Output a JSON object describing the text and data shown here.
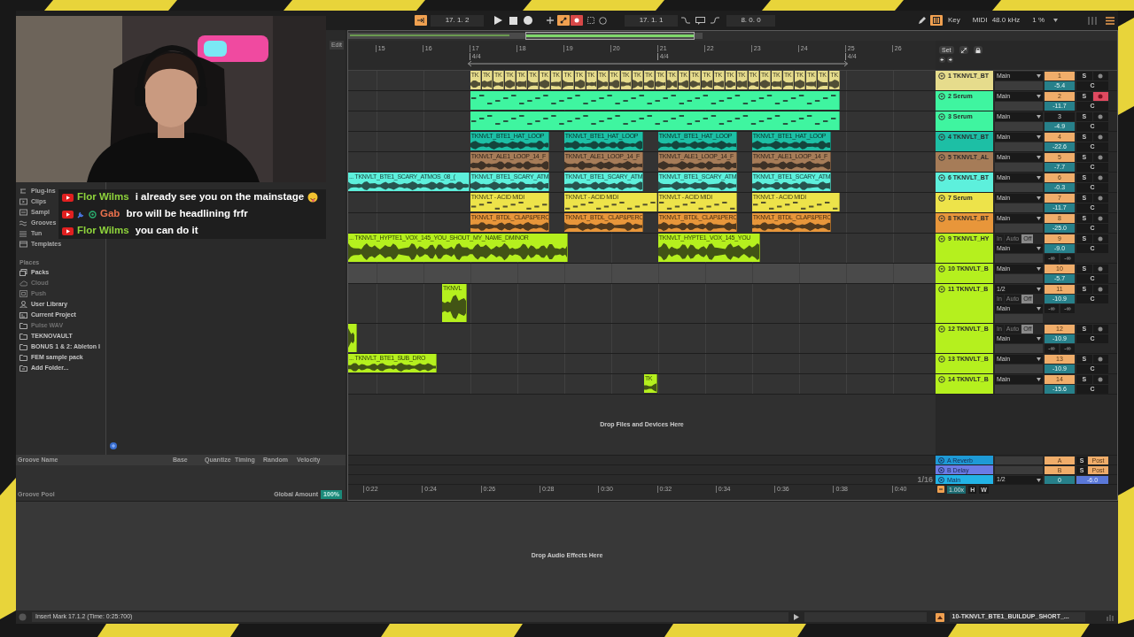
{
  "transport": {
    "position": "17. 1. 2",
    "loop_start": "17. 1. 1",
    "loop_length": "8. 0. 0",
    "key": "Key",
    "midi": "MIDI",
    "sample_rate": "48.0 kHz",
    "cpu": "1 %"
  },
  "chat": [
    {
      "author": "Flor Wilms",
      "color": "#8fd43c",
      "message": "i already see you on the mainstage",
      "kind": "viewer",
      "emoji": true
    },
    {
      "author": "Gab",
      "color": "#e8704c",
      "message": "bro will be headlining frfr",
      "kind": "moderator",
      "emoji": false
    },
    {
      "author": "Flor Wilms",
      "color": "#8fd43c",
      "message": "you can do it",
      "kind": "viewer",
      "emoji": false
    }
  ],
  "browser": {
    "edit": "Edit",
    "categories": [
      {
        "label": "Plug-ins",
        "kind": "plugins"
      },
      {
        "label": "Clips",
        "kind": "clips"
      },
      {
        "label": "Sampl",
        "kind": "samples"
      },
      {
        "label": "Grooves",
        "kind": "grooves"
      },
      {
        "label": "Tun",
        "kind": "tunings"
      },
      {
        "label": "Templates",
        "kind": "templates"
      }
    ],
    "places_title": "Places",
    "places": [
      {
        "label": "Packs",
        "kind": "packs",
        "disabled": false
      },
      {
        "label": "Cloud",
        "kind": "cloud",
        "disabled": true
      },
      {
        "label": "Push",
        "kind": "push",
        "disabled": true
      },
      {
        "label": "User Library",
        "kind": "user",
        "disabled": false
      },
      {
        "label": "Current Project",
        "kind": "project",
        "disabled": false
      },
      {
        "label": "Pulse WAV",
        "kind": "folder",
        "disabled": true
      },
      {
        "label": "TEKNOVAULT",
        "kind": "folder",
        "disabled": false
      },
      {
        "label": "BONUS 1 & 2: Ableton I",
        "kind": "folder",
        "disabled": false
      },
      {
        "label": "FEM sample pack",
        "kind": "folder",
        "disabled": false
      },
      {
        "label": "Add Folder...",
        "kind": "add",
        "disabled": false
      }
    ]
  },
  "groove_pool": {
    "columns": [
      "Groove Name",
      "Base",
      "Quantize",
      "Timing",
      "Random",
      "Velocity"
    ],
    "title": "Groove Pool",
    "amount_label": "Global Amount",
    "amount": "100%"
  },
  "arrangement": {
    "set": "Set",
    "bars": [
      {
        "label": "15"
      },
      {
        "label": "16"
      },
      {
        "label": "17",
        "signature": "4/4"
      },
      {
        "label": "18"
      },
      {
        "label": "19"
      },
      {
        "label": "20"
      },
      {
        "label": "21",
        "signature": "4/4"
      },
      {
        "label": "22"
      },
      {
        "label": "23"
      },
      {
        "label": "24"
      },
      {
        "label": "25",
        "signature": "4/4"
      },
      {
        "label": "26"
      }
    ],
    "tracks": [
      {
        "name": "1 TKNVLT_BT",
        "color": "#e6dc8c",
        "selected": false,
        "io": [
          {
            "kind": "route",
            "label": "Main"
          }
        ],
        "number": "1",
        "active": true,
        "volume": "-5.4",
        "solo": "S",
        "armed": false,
        "pan": "C",
        "clips": [
          {
            "kind": "audio",
            "name": "TK"
          },
          {
            "kind": "audio",
            "name": "TK"
          },
          {
            "kind": "audio",
            "name": "TK"
          },
          {
            "kind": "audio",
            "name": "TK"
          },
          {
            "kind": "audio",
            "name": "TK"
          },
          {
            "kind": "audio",
            "name": "TK"
          },
          {
            "kind": "audio",
            "name": "TK"
          },
          {
            "kind": "audio",
            "name": "TK"
          },
          {
            "kind": "audio",
            "name": "TK"
          },
          {
            "kind": "audio",
            "name": "TK"
          },
          {
            "kind": "audio",
            "name": "TK"
          },
          {
            "kind": "audio",
            "name": "TK"
          },
          {
            "kind": "audio",
            "name": "TK"
          },
          {
            "kind": "audio",
            "name": "TK"
          },
          {
            "kind": "audio",
            "name": "TK"
          },
          {
            "kind": "audio",
            "name": "TK"
          },
          {
            "kind": "audio",
            "name": "TK"
          },
          {
            "kind": "audio",
            "name": "TK"
          },
          {
            "kind": "audio",
            "name": "TK"
          },
          {
            "kind": "audio",
            "name": "TK"
          },
          {
            "kind": "audio",
            "name": "TK"
          },
          {
            "kind": "audio",
            "name": "TK"
          },
          {
            "kind": "audio",
            "name": "TK"
          },
          {
            "kind": "audio",
            "name": "TK"
          },
          {
            "kind": "audio",
            "name": "TK"
          },
          {
            "kind": "audio",
            "name": "TK"
          },
          {
            "kind": "audio",
            "name": "TK"
          },
          {
            "kind": "audio",
            "name": "TK"
          },
          {
            "kind": "audio",
            "name": "TK"
          },
          {
            "kind": "audio",
            "name": "TK"
          },
          {
            "kind": "audio",
            "name": "TK"
          },
          {
            "kind": "audio",
            "name": "TK"
          }
        ]
      },
      {
        "name": "2 Serum",
        "color": "#3ff5a0",
        "selected": false,
        "io": [
          {
            "kind": "route",
            "label": "Main"
          }
        ],
        "number": "2",
        "active": true,
        "volume": "-11.7",
        "solo": "S",
        "armed": true,
        "pan": "C",
        "clips": [
          {
            "kind": "midi"
          }
        ]
      },
      {
        "name": "3 Serum",
        "color": "#3ff5a0",
        "selected": false,
        "io": [
          {
            "kind": "route",
            "label": "Main"
          }
        ],
        "number": "3",
        "active": false,
        "volume": "-4.9",
        "solo": "S",
        "armed": false,
        "pan": "C",
        "clips": [
          {
            "kind": "midi"
          }
        ]
      },
      {
        "name": "4 TKNVLT_BT",
        "color": "#1dbfa5",
        "selected": false,
        "io": [
          {
            "kind": "route",
            "label": "Main"
          }
        ],
        "number": "4",
        "active": true,
        "volume": "-22.6",
        "solo": "S",
        "armed": false,
        "pan": "C",
        "clips": [
          {
            "kind": "audio",
            "name": "TKNVLT_BTE1_HAT_LOOP"
          },
          {
            "kind": "audio",
            "name": "TKNVLT_BTE1_HAT_LOOP"
          },
          {
            "kind": "audio",
            "name": "TKNVLT_BTE1_HAT_LOOP"
          },
          {
            "kind": "audio",
            "name": "TKNVLT_BTE1_HAT_LOOP"
          }
        ]
      },
      {
        "name": "5 TKNVLT_AL",
        "color": "#a67c58",
        "selected": false,
        "io": [
          {
            "kind": "route",
            "label": "Main"
          }
        ],
        "number": "5",
        "active": true,
        "volume": "-7.7",
        "solo": "S",
        "armed": false,
        "pan": "C",
        "clips": [
          {
            "kind": "audio",
            "name": "TKNVLT_ALE1_LOOP_14_F"
          },
          {
            "kind": "audio",
            "name": "TKNVLT_ALE1_LOOP_14_F"
          },
          {
            "kind": "audio",
            "name": "TKNVLT_ALE1_LOOP_14_F"
          },
          {
            "kind": "audio",
            "name": "TKNVLT_ALE1_LOOP_14_F"
          }
        ]
      },
      {
        "name": "6 TKNVLT_BT",
        "color": "#5df0dc",
        "selected": false,
        "io": [
          {
            "kind": "route",
            "label": "Main"
          }
        ],
        "number": "6",
        "active": true,
        "volume": "-0.3",
        "solo": "S",
        "armed": false,
        "pan": "C",
        "clips": [
          {
            "kind": "audio",
            "name": "... TKNVLT_BTE1_SCARY_ATMOS_08_("
          },
          {
            "kind": "audio",
            "name": "TKNVLT_BTE1_SCARY_ATM"
          },
          {
            "kind": "audio",
            "name": "TKNVLT_BTE1_SCARY_ATM"
          },
          {
            "kind": "audio",
            "name": "TKNVLT_BTE1_SCARY_ATM"
          },
          {
            "kind": "audio",
            "name": "TKNVLT_BTE1_SCARY_ATM"
          }
        ]
      },
      {
        "name": "7 Serum",
        "color": "#ede34a",
        "selected": false,
        "io": [
          {
            "kind": "route",
            "label": "Main"
          }
        ],
        "number": "7",
        "active": true,
        "volume": "-11.7",
        "solo": "S",
        "armed": false,
        "pan": "C",
        "clips": [
          {
            "kind": "midi",
            "name": "TKNVLT - ACID MIDI"
          },
          {
            "kind": "midi",
            "name": "TKNVLT - ACID MIDI"
          },
          {
            "kind": "midi",
            "name": "TKNVLT - ACID MIDI"
          },
          {
            "kind": "midi",
            "name": "TKNVLT - ACID MIDI"
          }
        ]
      },
      {
        "name": "8 TKNVLT_BT",
        "color": "#e8963a",
        "selected": false,
        "io": [
          {
            "kind": "route",
            "label": "Main"
          }
        ],
        "number": "8",
        "active": true,
        "volume": "-25.0",
        "solo": "S",
        "armed": false,
        "pan": "C",
        "clips": [
          {
            "kind": "audio",
            "name": "TKNVLT_BTDL_CLAP&PERC"
          },
          {
            "kind": "audio",
            "name": "TKNVLT_BTDL_CLAP&PERC"
          },
          {
            "kind": "audio",
            "name": "TKNVLT_BTDL_CLAP&PERC"
          },
          {
            "kind": "audio",
            "name": "TKNVLT_BTDL_CLAP&PERC"
          }
        ]
      },
      {
        "name": "9 TKNVLT_HY",
        "color": "#b5f01e",
        "selected": false,
        "io": [
          {
            "kind": "monitor",
            "options": [
              {
                "label": "In",
                "selected": false
              },
              {
                "label": "Auto",
                "selected": false
              },
              {
                "label": "Off",
                "selected": true
              }
            ]
          },
          {
            "kind": "route",
            "label": "Main"
          }
        ],
        "number": "9",
        "active": true,
        "volume": "-9.0",
        "peaks": [
          "-∞",
          "-∞"
        ],
        "solo": "S",
        "armed": false,
        "pan": "C",
        "clips": [
          {
            "kind": "audio",
            "name": "... TKNVLT_HYPTE1_VOX_145_YOU_SHOUT_MY_NAME_DMINOR"
          },
          {
            "kind": "audio",
            "name": "TKNVLT_HYPTE1_VOX_145_YOU"
          }
        ]
      },
      {
        "name": "10 TKNVLT_B",
        "color": "#b5f01e",
        "selected": true,
        "io": [
          {
            "kind": "route",
            "label": "Main"
          }
        ],
        "number": "10",
        "active": true,
        "volume": "-5.7",
        "solo": "S",
        "armed": false,
        "pan": "C"
      },
      {
        "name": "11 TKNVLT_B",
        "color": "#b5f01e",
        "selected": false,
        "io": [
          {
            "kind": "route",
            "label": "1/2"
          },
          {
            "kind": "monitor",
            "options": [
              {
                "label": "In",
                "selected": false
              },
              {
                "label": "Auto",
                "selected": false
              },
              {
                "label": "Off",
                "selected": true
              }
            ]
          },
          {
            "kind": "route",
            "label": "Main"
          }
        ],
        "number": "11",
        "active": true,
        "volume": "-10.9",
        "peaks": [
          "-∞",
          "-∞"
        ],
        "solo": "S",
        "armed": false,
        "pan": "C",
        "clips": [
          {
            "kind": "audio",
            "name": "TKNVL"
          }
        ]
      },
      {
        "name": "12 TKNVLT_B",
        "color": "#b5f01e",
        "selected": false,
        "io": [
          {
            "kind": "monitor",
            "options": [
              {
                "label": "In",
                "selected": false
              },
              {
                "label": "Auto",
                "selected": false
              },
              {
                "label": "Off",
                "selected": true
              }
            ]
          },
          {
            "kind": "route",
            "label": "Main"
          }
        ],
        "number": "12",
        "active": true,
        "volume": "-10.9",
        "peaks": [
          "-∞",
          "-∞"
        ],
        "solo": "S",
        "armed": false,
        "pan": "C",
        "clips": [
          {
            "kind": "audio"
          }
        ]
      },
      {
        "name": "13 TKNVLT_B",
        "color": "#b5f01e",
        "selected": false,
        "io": [
          {
            "kind": "route",
            "label": "Main"
          }
        ],
        "number": "13",
        "active": true,
        "volume": "-10.9",
        "solo": "S",
        "armed": false,
        "pan": "C",
        "clips": [
          {
            "kind": "audio",
            "name": "... TKNVLT_BTE1_SUB_DRO"
          }
        ]
      },
      {
        "name": "14 TKNVLT_B",
        "color": "#b5f01e",
        "selected": false,
        "io": [
          {
            "kind": "route",
            "label": "Main"
          }
        ],
        "number": "14",
        "active": true,
        "volume": "-15.6",
        "solo": "S",
        "armed": false,
        "pan": "C",
        "clips": [
          {
            "kind": "audio",
            "name": "TK"
          }
        ]
      }
    ],
    "drop_hint": "Drop Files and Devices Here",
    "returns": [
      {
        "kind": "return",
        "name": "A Reverb",
        "color": "#1e9ad6",
        "send": "A",
        "solo": "S",
        "mode": "Post"
      },
      {
        "kind": "return",
        "name": "B Delay",
        "color": "#6b7be6",
        "send": "B",
        "solo": "S",
        "mode": "Post"
      },
      {
        "kind": "main",
        "name": "Main",
        "color": "#22b3e6",
        "route": "1/2",
        "volume": "0",
        "pan": "-6.0",
        "grid": "1/16"
      }
    ],
    "times": [
      "0:22",
      "0:24",
      "0:26",
      "0:28",
      "0:30",
      "0:32",
      "0:34",
      "0:36",
      "0:38",
      "0:40"
    ],
    "zoom": "1.00x",
    "h": "H",
    "w": "W"
  },
  "device_hint": "Drop Audio Effects Here",
  "status": {
    "message": "Insert Mark 17.1.2 (Time: 0:25:700)",
    "clip": "10-TKNVLT_BTE1_BUILDUP_SHORT_..."
  }
}
